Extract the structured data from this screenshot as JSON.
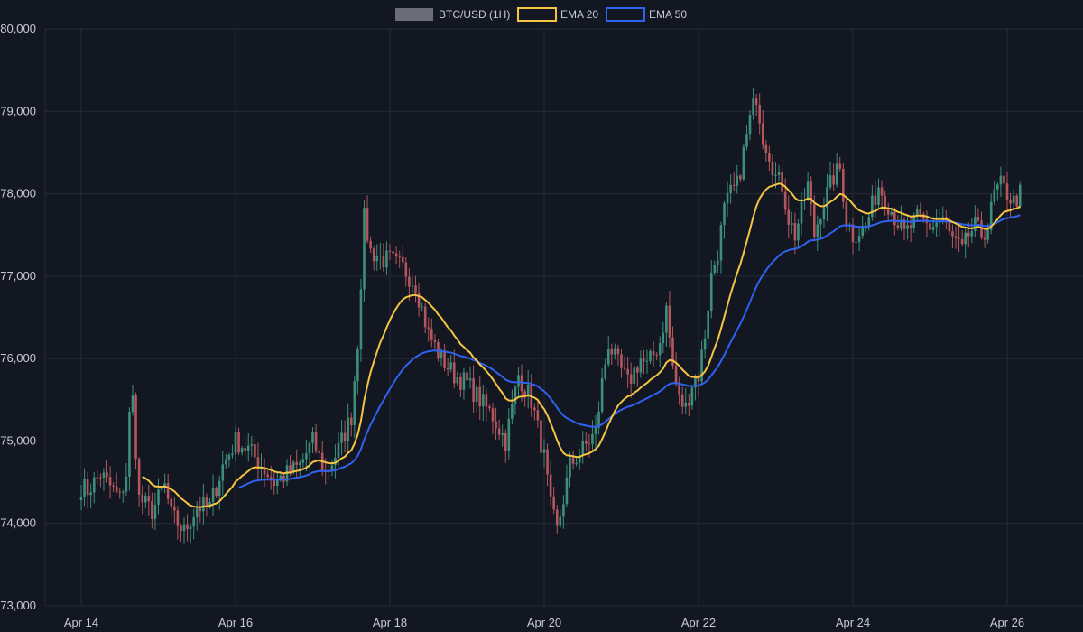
{
  "chart_data": {
    "type": "candlestick",
    "legend": {
      "placement": "top-center",
      "items": [
        {
          "label": "BTC/USD (1H)",
          "swatch": "#6b6e76"
        },
        {
          "label": "EMA 20",
          "swatch": "#f5c542"
        },
        {
          "label": "EMA 50",
          "swatch": "#2f62f0"
        }
      ]
    },
    "colors": {
      "background": "#131722",
      "grid": "#262b36",
      "up": "#3d8f7c",
      "down": "#b4565c",
      "ema20": "#f5c542",
      "ema50": "#2f62f0",
      "text": "#c7cbd4"
    },
    "grid": true,
    "ylim": [
      73000,
      80000
    ],
    "xlim_days": [
      "Apr 14",
      "Apr 26 ~12:00"
    ],
    "y_ticks": [
      {
        "value": 73000,
        "label": "73,000"
      },
      {
        "value": 74000,
        "label": "74,000"
      },
      {
        "value": 75000,
        "label": "75,000"
      },
      {
        "value": 76000,
        "label": "76,000"
      },
      {
        "value": 77000,
        "label": "77,000"
      },
      {
        "value": 78000,
        "label": "78,000"
      },
      {
        "value": 79000,
        "label": "79,000"
      },
      {
        "value": 80000,
        "label": "80,000"
      }
    ],
    "x_ticks": [
      {
        "label": "Apr 14",
        "day": 0
      },
      {
        "label": "Apr 16",
        "day": 2
      },
      {
        "label": "Apr 18",
        "day": 4
      },
      {
        "label": "Apr 20",
        "day": 6
      },
      {
        "label": "Apr 22",
        "day": 8
      },
      {
        "label": "Apr 24",
        "day": 10
      },
      {
        "label": "Apr 26",
        "day": 12
      }
    ],
    "close_anchors": [
      [
        0,
        74450
      ],
      [
        2,
        74400
      ],
      [
        6,
        74600
      ],
      [
        8,
        74500
      ],
      [
        12,
        74300
      ],
      [
        14,
        74600
      ],
      [
        15,
        75300
      ],
      [
        16,
        75500
      ],
      [
        18,
        74300
      ],
      [
        22,
        74150
      ],
      [
        26,
        74450
      ],
      [
        28,
        74100
      ],
      [
        32,
        73900
      ],
      [
        36,
        74200
      ],
      [
        40,
        74200
      ],
      [
        44,
        74700
      ],
      [
        48,
        75000
      ],
      [
        52,
        74900
      ],
      [
        56,
        74700
      ],
      [
        60,
        74500
      ],
      [
        64,
        74600
      ],
      [
        68,
        74700
      ],
      [
        72,
        75000
      ],
      [
        76,
        74600
      ],
      [
        80,
        74900
      ],
      [
        84,
        75300
      ],
      [
        86,
        76200
      ],
      [
        88,
        77700
      ],
      [
        90,
        77300
      ],
      [
        94,
        77200
      ],
      [
        96,
        77200
      ],
      [
        100,
        77100
      ],
      [
        104,
        76900
      ],
      [
        108,
        76300
      ],
      [
        112,
        76000
      ],
      [
        116,
        75800
      ],
      [
        120,
        75700
      ],
      [
        124,
        75500
      ],
      [
        128,
        75300
      ],
      [
        132,
        75000
      ],
      [
        136,
        75800
      ],
      [
        140,
        75500
      ],
      [
        144,
        74800
      ],
      [
        146,
        74200
      ],
      [
        148,
        73900
      ],
      [
        150,
        74300
      ],
      [
        152,
        74700
      ],
      [
        156,
        74900
      ],
      [
        160,
        75100
      ],
      [
        162,
        75700
      ],
      [
        164,
        76200
      ],
      [
        166,
        76000
      ],
      [
        170,
        75700
      ],
      [
        174,
        76000
      ],
      [
        176,
        75900
      ],
      [
        180,
        76200
      ],
      [
        182,
        76600
      ],
      [
        184,
        75900
      ],
      [
        186,
        75500
      ],
      [
        188,
        75400
      ],
      [
        190,
        75700
      ],
      [
        192,
        75800
      ],
      [
        194,
        76300
      ],
      [
        196,
        77000
      ],
      [
        198,
        77300
      ],
      [
        200,
        77800
      ],
      [
        202,
        78000
      ],
      [
        204,
        78100
      ],
      [
        206,
        78500
      ],
      [
        208,
        78900
      ],
      [
        210,
        79200
      ],
      [
        212,
        78700
      ],
      [
        214,
        78500
      ],
      [
        216,
        78200
      ],
      [
        218,
        78100
      ],
      [
        220,
        77700
      ],
      [
        222,
        77500
      ],
      [
        224,
        77800
      ],
      [
        226,
        78100
      ],
      [
        228,
        77500
      ],
      [
        230,
        77800
      ],
      [
        234,
        78200
      ],
      [
        236,
        78300
      ],
      [
        238,
        77700
      ],
      [
        240,
        77500
      ],
      [
        244,
        77600
      ],
      [
        248,
        78100
      ],
      [
        252,
        77800
      ],
      [
        256,
        77500
      ],
      [
        260,
        77700
      ],
      [
        264,
        77600
      ],
      [
        268,
        77700
      ],
      [
        270,
        77500
      ],
      [
        272,
        77400
      ],
      [
        274,
        77300
      ],
      [
        276,
        77500
      ],
      [
        278,
        77600
      ],
      [
        280,
        77500
      ],
      [
        282,
        77600
      ],
      [
        284,
        78000
      ],
      [
        286,
        78100
      ],
      [
        288,
        78000
      ],
      [
        290,
        77900
      ],
      [
        292,
        78000
      ]
    ],
    "ema20": {
      "name": "EMA 20",
      "period": 20
    },
    "ema50": {
      "name": "EMA 50",
      "period": 50
    }
  }
}
